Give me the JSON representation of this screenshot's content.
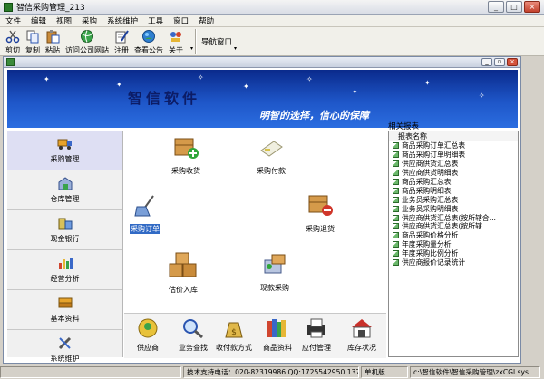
{
  "window": {
    "title": "智信采购管理_213",
    "minimize": "_",
    "maximize": "□",
    "close": "×"
  },
  "menu": [
    "文件",
    "编辑",
    "视图",
    "采购",
    "系统维护",
    "工具",
    "窗口",
    "帮助"
  ],
  "toolbar": {
    "buttons": [
      "剪切",
      "复制",
      "粘贴",
      "访问公司网站",
      "注册",
      "查看公告",
      "关于"
    ],
    "nav_window": "导航窗口"
  },
  "mdi": {
    "minimize": "_",
    "restore": "▫",
    "close": "×"
  },
  "banner": {
    "brand": "智信软件",
    "slogan": "明智的选择，信心的保障"
  },
  "leftnav": [
    "采购管理",
    "仓库管理",
    "现金银行",
    "经营分析",
    "基本资料",
    "系统维护"
  ],
  "flow": {
    "purchase_receipt": "采购收货",
    "purchase_payment": "采购付款",
    "purchase_order": "采购订单",
    "purchase_return": "采购退货",
    "valuation_inbound": "估价入库",
    "cash_purchase": "现款采购"
  },
  "bottom": [
    "供应商",
    "业务查找",
    "收付款方式",
    "商品资料",
    "应付管理",
    "库存状况"
  ],
  "reports": {
    "panel_title": "相关报表",
    "column_header": "报表名称",
    "items": [
      "商品采购订单汇总表",
      "商品采购订单明细表",
      "供应商供货汇总表",
      "供应商供货明细表",
      "商品采购汇总表",
      "商品采购明细表",
      "业务员采购汇总表",
      "业务员采购明细表",
      "供应商供货汇总表(按所辖合...",
      "供应商供货汇总表(按所辖...",
      "商品采购价格分析",
      "年度采购量分析",
      "年度采购比例分析",
      "供应商报价记录统计"
    ]
  },
  "status": {
    "empty": "",
    "support": "技术支持电话：020-82319986 QQ:1725542950 137028858",
    "mode": "单机版",
    "path": "c:\\智信软件\\智信采购管理\\zxCGl.sys"
  }
}
